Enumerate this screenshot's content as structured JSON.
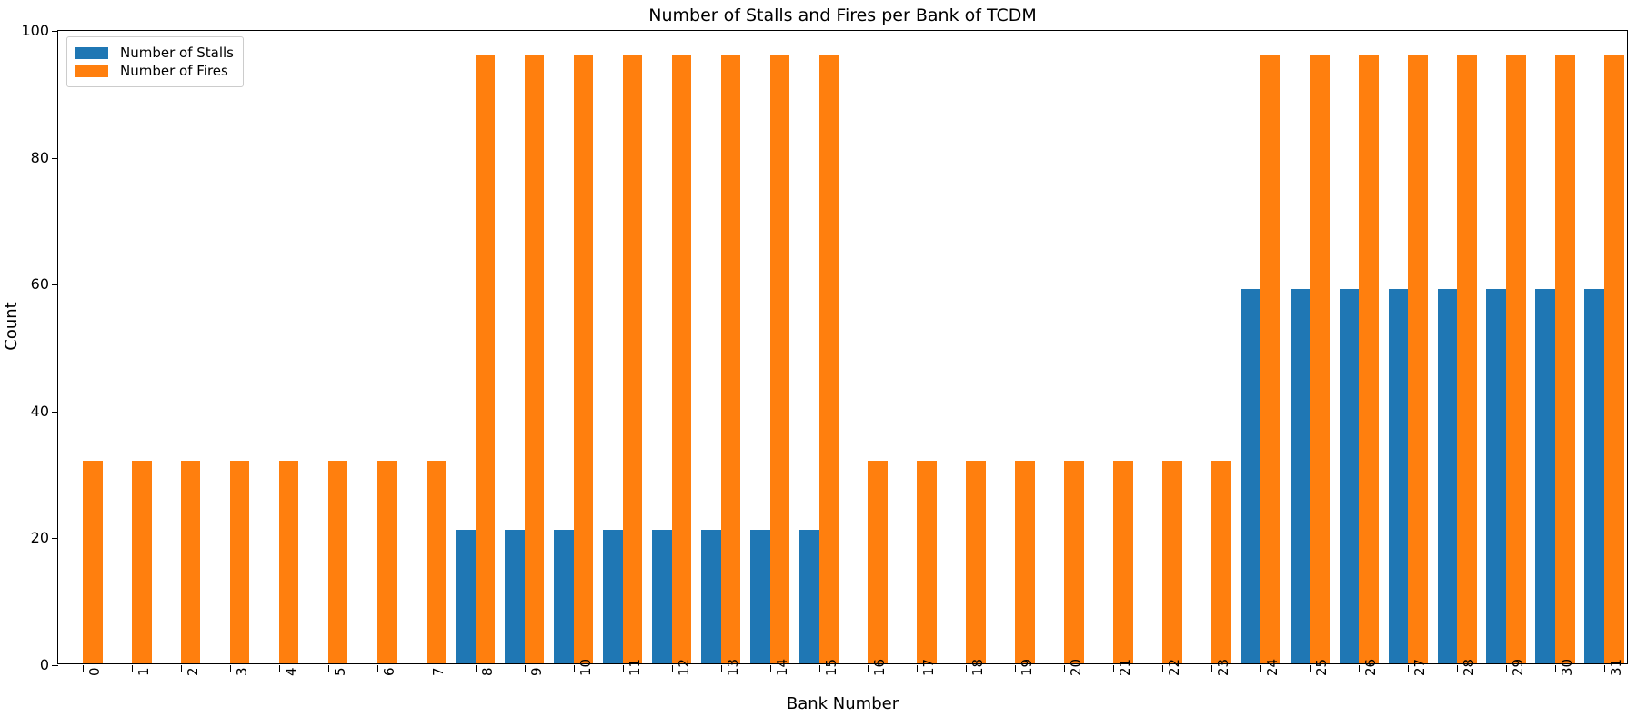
{
  "chart_data": {
    "type": "bar",
    "title": "Number of Stalls and Fires per Bank of TCDM",
    "xlabel": "Bank Number",
    "ylabel": "Count",
    "ylim": [
      0,
      100
    ],
    "yticks": [
      0,
      20,
      40,
      60,
      80,
      100
    ],
    "ytick_labels": [
      "0",
      "20",
      "40",
      "60",
      "80",
      "100"
    ],
    "grid": false,
    "legend_position": "upper left",
    "categories": [
      "0",
      "1",
      "2",
      "3",
      "4",
      "5",
      "6",
      "7",
      "8",
      "9",
      "10",
      "11",
      "12",
      "13",
      "14",
      "15",
      "16",
      "17",
      "18",
      "19",
      "20",
      "21",
      "22",
      "23",
      "24",
      "25",
      "26",
      "27",
      "28",
      "29",
      "30",
      "31"
    ],
    "series": [
      {
        "name": "Number of Stalls",
        "color": "#1f77b4",
        "values": [
          0,
          0,
          0,
          0,
          0,
          0,
          0,
          0,
          21,
          21,
          21,
          21,
          21,
          21,
          21,
          21,
          0,
          0,
          0,
          0,
          0,
          0,
          0,
          0,
          59,
          59,
          59,
          59,
          59,
          59,
          59,
          59
        ]
      },
      {
        "name": "Number of Fires",
        "color": "#ff7f0e",
        "values": [
          32,
          32,
          32,
          32,
          32,
          32,
          32,
          32,
          96,
          96,
          96,
          96,
          96,
          96,
          96,
          96,
          32,
          32,
          32,
          32,
          32,
          32,
          32,
          32,
          96,
          96,
          96,
          96,
          96,
          96,
          96,
          96
        ]
      }
    ]
  },
  "legend": {
    "entries": [
      {
        "label": "Number of Stalls",
        "color": "#1f77b4"
      },
      {
        "label": "Number of Fires",
        "color": "#ff7f0e"
      }
    ]
  }
}
